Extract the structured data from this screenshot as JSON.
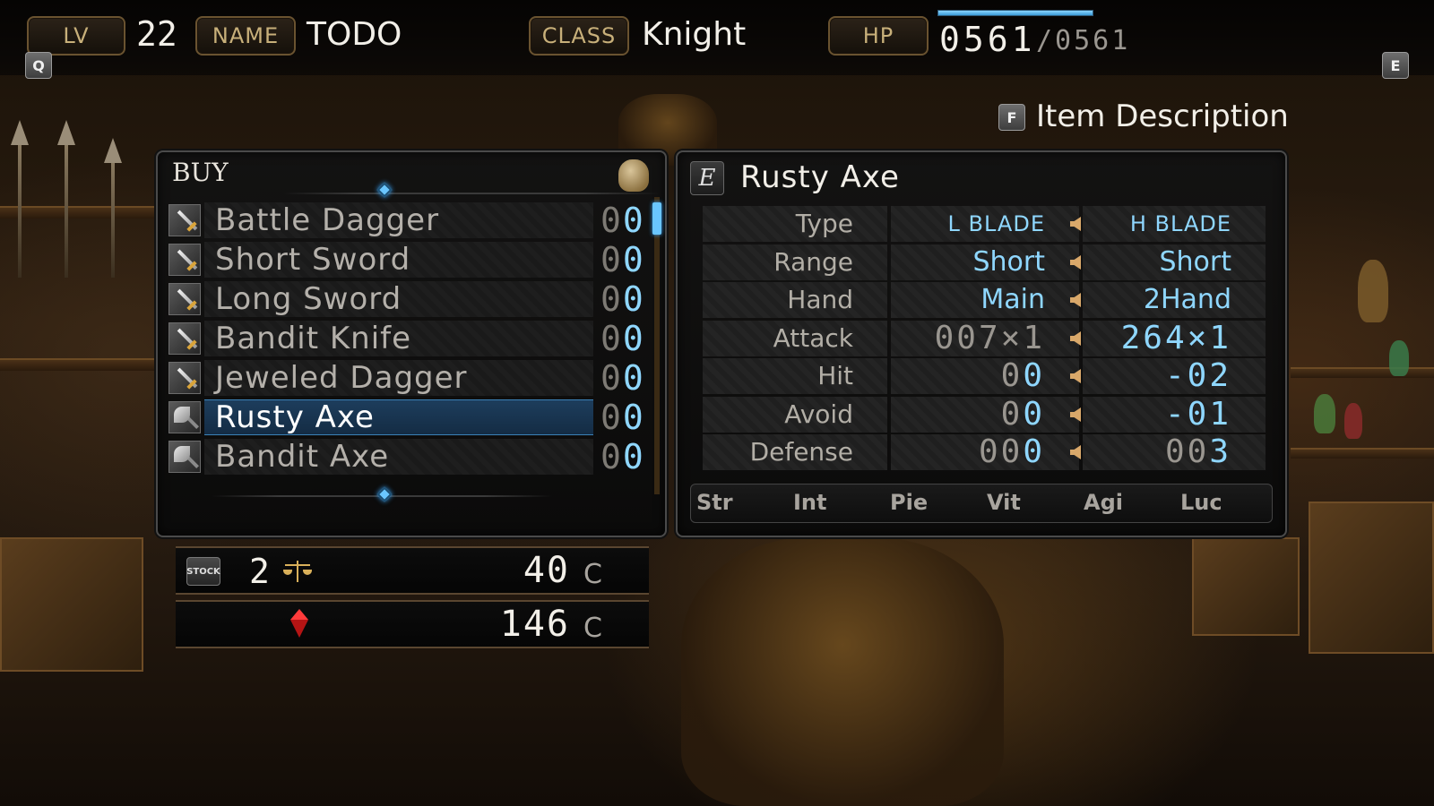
{
  "header": {
    "lv_tag": "LV",
    "lv_value": "22",
    "name_tag": "NAME",
    "name_value": "TODO",
    "class_tag": "CLASS",
    "class_value": "Knight",
    "hp_tag": "HP",
    "hp_current": "0561",
    "hp_max": "/0561",
    "hp_fill_fraction": 1.0,
    "q_key": "Q",
    "e_key": "E"
  },
  "description": {
    "key": "F",
    "label": "Item Description"
  },
  "buy": {
    "title": "BUY",
    "items": [
      {
        "name": "Battle Dagger",
        "count_dim": "0",
        "count_hi": "0",
        "icon": "dagger-icon",
        "selected": false
      },
      {
        "name": "Short Sword",
        "count_dim": "0",
        "count_hi": "0",
        "icon": "sword-icon",
        "selected": false
      },
      {
        "name": "Long Sword",
        "count_dim": "0",
        "count_hi": "0",
        "icon": "sword-icon",
        "selected": false
      },
      {
        "name": "Bandit Knife",
        "count_dim": "0",
        "count_hi": "0",
        "icon": "knife-icon",
        "selected": false
      },
      {
        "name": "Jeweled Dagger",
        "count_dim": "0",
        "count_hi": "0",
        "icon": "dagger-icon",
        "selected": false
      },
      {
        "name": "Rusty Axe",
        "count_dim": "0",
        "count_hi": "0",
        "icon": "axe-icon",
        "selected": true
      },
      {
        "name": "Bandit Axe",
        "count_dim": "0",
        "count_hi": "0",
        "icon": "axe-icon",
        "selected": false
      }
    ]
  },
  "price": {
    "stock_tag": "STOCK",
    "stock_value": "2",
    "cost": "40",
    "cost_unit": "C",
    "funds": "146",
    "funds_unit": "C"
  },
  "detail": {
    "key": "E",
    "title": "Rusty Axe",
    "stats": [
      {
        "label": "Type",
        "left": "L BLADE",
        "right": "H BLADE",
        "style": "small"
      },
      {
        "label": "Range",
        "left": "Short",
        "right": "Short",
        "style": "med"
      },
      {
        "label": "Hand",
        "left": "Main",
        "right": "2Hand",
        "style": "med"
      },
      {
        "label": "Attack",
        "left_dim": "007×1",
        "left_hi": "",
        "right_dim": "",
        "right_hi": "264×1",
        "style": "num"
      },
      {
        "label": "Hit",
        "left_dim": "0",
        "left_hi": "0",
        "right_dim": "",
        "right_hi": "-02",
        "style": "num"
      },
      {
        "label": "Avoid",
        "left_dim": "0",
        "left_hi": "0",
        "right_dim": "",
        "right_hi": "-01",
        "style": "num"
      },
      {
        "label": "Defense",
        "left_dim": "00",
        "left_hi": "0",
        "right_dim": "00",
        "right_hi": "3",
        "style": "num"
      }
    ],
    "attributes": [
      "Str",
      "Int",
      "Pie",
      "Vit",
      "Agi",
      "Luc"
    ]
  },
  "colors": {
    "accent_blue": "#8fd7ff",
    "tag_gold": "#c8b07a",
    "selection": "#1d3d5c"
  }
}
